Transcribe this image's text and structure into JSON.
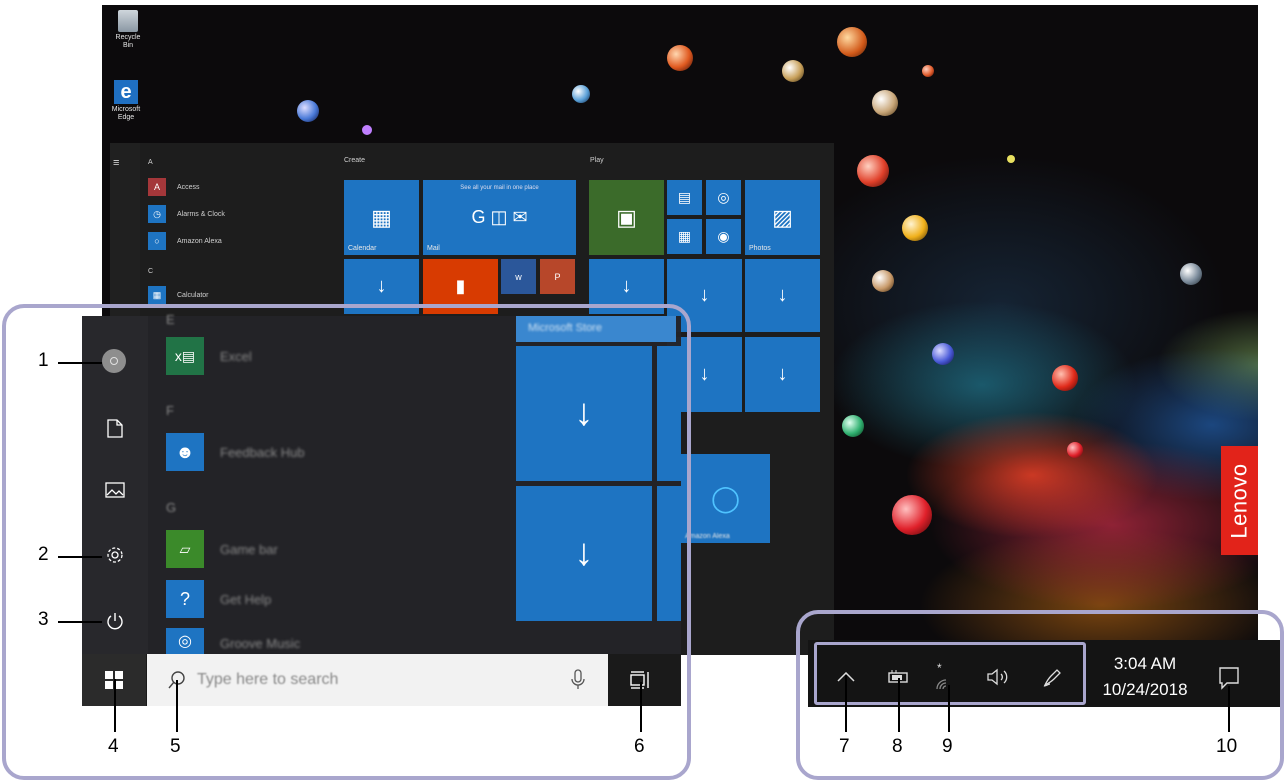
{
  "desktop": {
    "icons": [
      {
        "label": "Recycle Bin"
      },
      {
        "label": "Microsoft Edge"
      }
    ],
    "brand": "Lenovo"
  },
  "start_menu": {
    "apps_header_a": "A",
    "apps": [
      "Access",
      "Alarms & Clock",
      "Amazon Alexa",
      "Calculator"
    ],
    "apps_header_c": "C",
    "groups": {
      "create": "Create",
      "play": "Play"
    },
    "tiles": {
      "calendar": "Calendar",
      "mail": "Mail",
      "mail_tagline": "See all your mail in one place",
      "photos": "Photos",
      "store": "Microsoft Store",
      "alexa": "Amazon Alexa"
    },
    "zoom_apps": [
      "Excel",
      "Feedback Hub",
      "Game bar",
      "Get Help",
      "Groove Music"
    ],
    "zoom_headers": [
      "E",
      "F",
      "G"
    ]
  },
  "taskbar": {
    "search_placeholder": "Type here to search",
    "time": "3:04 AM",
    "date": "10/24/2018"
  },
  "callouts": [
    "1",
    "2",
    "3",
    "4",
    "5",
    "6",
    "7",
    "8",
    "9",
    "10"
  ]
}
